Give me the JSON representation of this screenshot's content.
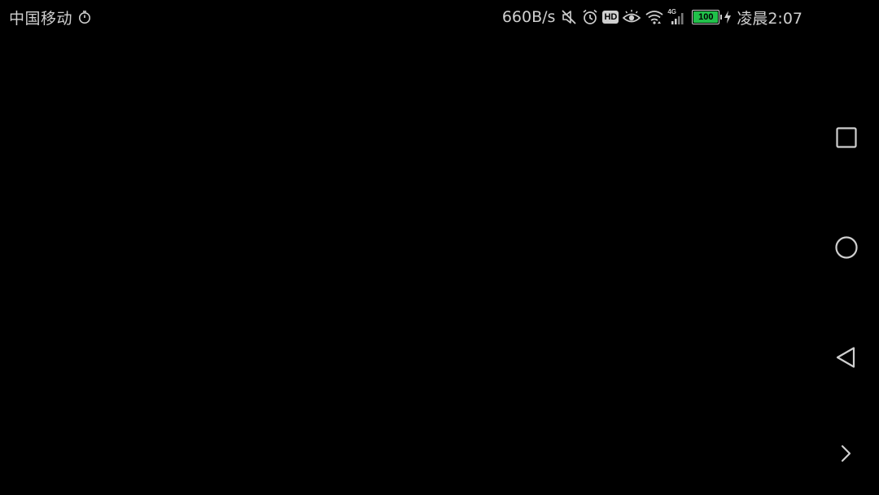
{
  "status_bar": {
    "carrier": "中国移动",
    "net_speed": "660B/s",
    "hd_badge": "HD",
    "network_type": "4G",
    "battery_level": "100",
    "battery_fraction": 1.0,
    "battery_color": "#21c04a",
    "time": "凌晨2:07",
    "icons": [
      "stopwatch-icon",
      "mute-icon",
      "alarm-icon",
      "hd-icon",
      "eye-comfort-icon",
      "wifi-icon",
      "cellular-signal-icon",
      "battery-icon",
      "charging-icon"
    ]
  },
  "navigation_bar": {
    "buttons": [
      "recent-apps",
      "home",
      "back",
      "expand"
    ]
  },
  "theme": {
    "background": "#000000",
    "foreground": "#cfcfcf"
  }
}
